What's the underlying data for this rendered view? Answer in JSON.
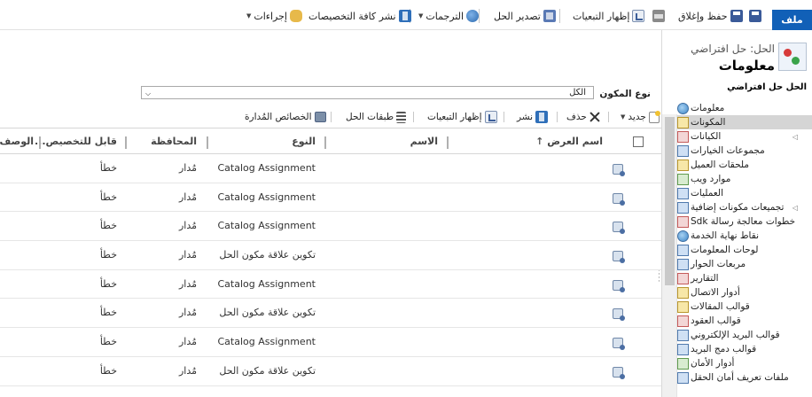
{
  "ribbon": {
    "file": "ملف",
    "save": "",
    "save_close": "حفظ وإغلاق",
    "print": "",
    "show_dependencies": "إظهار التبعيات",
    "export": "تصدير الحل",
    "translations": "الترجمات",
    "publish_all": "نشر كافة التخصيصات",
    "actions": "إجراءات"
  },
  "solution": {
    "label": "الحل: حل افتراضي",
    "section_title": "معلومات"
  },
  "nav": {
    "heading": "الحل حل افتراضي",
    "items": [
      {
        "label": "معلومات",
        "icon": "info-icon",
        "selected": false,
        "level": 0
      },
      {
        "label": "المكونات",
        "icon": "components-icon",
        "selected": true,
        "level": 0
      },
      {
        "label": "الكيانات",
        "icon": "entities-icon",
        "selected": false,
        "level": 1,
        "expandable": true
      },
      {
        "label": "مجموعات الخيارات",
        "icon": "option-sets-icon",
        "selected": false,
        "level": 1
      },
      {
        "label": "ملحقات العميل",
        "icon": "client-extensions-icon",
        "selected": false,
        "level": 1
      },
      {
        "label": "موارد ويب",
        "icon": "web-resources-icon",
        "selected": false,
        "level": 1
      },
      {
        "label": "العمليات",
        "icon": "processes-icon",
        "selected": false,
        "level": 1
      },
      {
        "label": "تجميعات مكونات إضافية",
        "icon": "plugin-assemblies-icon",
        "selected": false,
        "level": 1,
        "expandable": true
      },
      {
        "label": "خطوات معالجة رسالة Sdk",
        "icon": "sdk-steps-icon",
        "selected": false,
        "level": 1
      },
      {
        "label": "نقاط نهاية الخدمة",
        "icon": "service-endpoints-icon",
        "selected": false,
        "level": 1
      },
      {
        "label": "لوحات المعلومات",
        "icon": "dashboards-icon",
        "selected": false,
        "level": 1
      },
      {
        "label": "مربعات الحوار",
        "icon": "dialogs-icon",
        "selected": false,
        "level": 1
      },
      {
        "label": "التقارير",
        "icon": "reports-icon",
        "selected": false,
        "level": 1
      },
      {
        "label": "أدوار الاتصال",
        "icon": "connection-roles-icon",
        "selected": false,
        "level": 1
      },
      {
        "label": "قوالب المقالات",
        "icon": "article-templates-icon",
        "selected": false,
        "level": 1
      },
      {
        "label": "قوالب العقود",
        "icon": "contract-templates-icon",
        "selected": false,
        "level": 1
      },
      {
        "label": "قوالب البريد الإلكتروني",
        "icon": "email-templates-icon",
        "selected": false,
        "level": 1
      },
      {
        "label": "قوالب دمج البريد",
        "icon": "mail-merge-templates-icon",
        "selected": false,
        "level": 1
      },
      {
        "label": "أدوار الأمان",
        "icon": "security-roles-icon",
        "selected": false,
        "level": 1
      },
      {
        "label": "ملفات تعريف أمان الحقل",
        "icon": "field-security-icon",
        "selected": false,
        "level": 1
      }
    ]
  },
  "filter": {
    "label": "نوع المكون",
    "value": "الكل"
  },
  "toolbar": {
    "new": "جديد",
    "delete": "حذف",
    "publish": "نشر",
    "show_dependencies": "إظهار التبعيات",
    "solution_layers": "طبقات الحل",
    "managed_properties": "الخصائص المُدارة"
  },
  "grid": {
    "columns": {
      "display_name": "اسم العرض",
      "name": "الاسم",
      "type": "النوع",
      "state": "المحافظة",
      "customizable": "قابل للتخصيص...",
      "description": "الوصف"
    },
    "rows": [
      {
        "type": "Catalog Assignment",
        "state": "مُدار",
        "customizable": "خطأ"
      },
      {
        "type": "Catalog Assignment",
        "state": "مُدار",
        "customizable": "خطأ"
      },
      {
        "type": "Catalog Assignment",
        "state": "مُدار",
        "customizable": "خطأ"
      },
      {
        "type": "تكوين علاقة مكون الحل",
        "state": "مُدار",
        "customizable": "خطأ"
      },
      {
        "type": "Catalog Assignment",
        "state": "مُدار",
        "customizable": "خطأ"
      },
      {
        "type": "تكوين علاقة مكون الحل",
        "state": "مُدار",
        "customizable": "خطأ"
      },
      {
        "type": "Catalog Assignment",
        "state": "مُدار",
        "customizable": "خطأ"
      },
      {
        "type": "تكوين علاقة مكون الحل",
        "state": "مُدار",
        "customizable": "خطأ"
      }
    ]
  }
}
